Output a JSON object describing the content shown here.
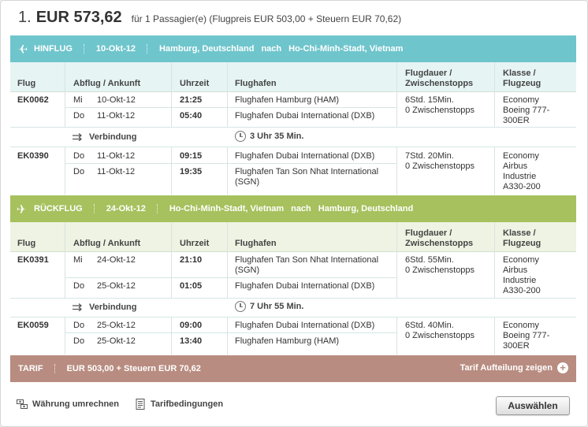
{
  "price": {
    "index": "1.",
    "amount": "EUR 573,62",
    "note": "für 1 Passagier(e) (Flugpreis EUR 503,00 + Steuern EUR 70,62)"
  },
  "headers": {
    "flug": "Flug",
    "abflug": "Abflug / Ankunft",
    "uhrzeit": "Uhrzeit",
    "flughafen": "Flughafen",
    "dauer1": "Flugdauer /",
    "dauer2": "Zwischenstopps",
    "klasse1": "Klasse /",
    "klasse2": "Flugzeug"
  },
  "outbound": {
    "label": "HINFLUG",
    "date": "10-Okt-12",
    "from": "Hamburg, Deutschland",
    "nach": "nach",
    "to": "Ho-Chi-Minh-Stadt, Vietnam",
    "flights": [
      {
        "number": "EK0062",
        "dep_day": "Mi",
        "dep_date": "10-Okt-12",
        "dep_time": "21:25",
        "dep_airport": "Flughafen Hamburg (HAM)",
        "arr_day": "Do",
        "arr_date": "11-Okt-12",
        "arr_time": "05:40",
        "arr_airport": "Flughafen Dubai International (DXB)",
        "duration": "6Std. 15Min.",
        "stops": "0 Zwischenstopps",
        "class": "Economy",
        "aircraft1": "Boeing 777-",
        "aircraft2": "300ER",
        "aircraft3": ""
      },
      {
        "number": "EK0390",
        "dep_day": "Do",
        "dep_date": "11-Okt-12",
        "dep_time": "09:15",
        "dep_airport": "Flughafen Dubai International (DXB)",
        "arr_day": "Do",
        "arr_date": "11-Okt-12",
        "arr_time": "19:35",
        "arr_airport": "Flughafen Tan Son Nhat International",
        "arr_airport2": "(SGN)",
        "duration": "7Std. 20Min.",
        "stops": "0 Zwischenstopps",
        "class": "Economy",
        "aircraft1": "Airbus",
        "aircraft2": "Industrie",
        "aircraft3": "A330-200"
      }
    ],
    "connection_label": "Verbindung",
    "connection_time": "3 Uhr 35 Min."
  },
  "return": {
    "label": "RÜCKFLUG",
    "date": "24-Okt-12",
    "from": "Ho-Chi-Minh-Stadt, Vietnam",
    "nach": "nach",
    "to": "Hamburg, Deutschland",
    "flights": [
      {
        "number": "EK0391",
        "dep_day": "Mi",
        "dep_date": "24-Okt-12",
        "dep_time": "21:10",
        "dep_airport": "Flughafen Tan Son Nhat International",
        "dep_airport2": "(SGN)",
        "arr_day": "Do",
        "arr_date": "25-Okt-12",
        "arr_time": "01:05",
        "arr_airport": "Flughafen Dubai International (DXB)",
        "duration": "6Std. 55Min.",
        "stops": "0 Zwischenstopps",
        "class": "Economy",
        "aircraft1": "Airbus",
        "aircraft2": "Industrie",
        "aircraft3": "A330-200"
      },
      {
        "number": "EK0059",
        "dep_day": "Do",
        "dep_date": "25-Okt-12",
        "dep_time": "09:00",
        "dep_airport": "Flughafen Dubai International (DXB)",
        "arr_day": "Do",
        "arr_date": "25-Okt-12",
        "arr_time": "13:40",
        "arr_airport": "Flughafen Hamburg (HAM)",
        "duration": "6Std. 40Min.",
        "stops": "0 Zwischenstopps",
        "class": "Economy",
        "aircraft1": "Boeing 777-",
        "aircraft2": "300ER",
        "aircraft3": ""
      }
    ],
    "connection_label": "Verbindung",
    "connection_time": "7 Uhr 55 Min."
  },
  "tarif": {
    "label": "TARIF",
    "amount": "EUR 503,00 + Steuern EUR 70,62",
    "breakdown_link": "Tarif Aufteilung zeigen"
  },
  "footer": {
    "currency_link": "Währung umrechnen",
    "conditions_link": "Tarifbedingungen",
    "select_button": "Auswählen"
  },
  "colors": {
    "outbound_bar": "#6fc5cc",
    "return_bar": "#a6c15d",
    "tarif_bar": "#b88c80"
  },
  "icons": {
    "plane": "plane-icon",
    "connection": "connection-arrows-icon",
    "clock": "clock-icon",
    "plus": "plus-circle-icon",
    "currency": "currency-convert-icon",
    "conditions": "document-icon"
  }
}
